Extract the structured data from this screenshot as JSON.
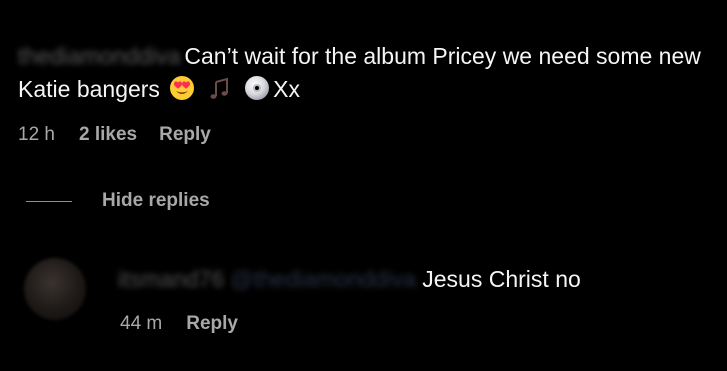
{
  "comment": {
    "username": "thediamonddiva",
    "text": "Can’t wait for the album Pricey we need some new Katie bangers",
    "emojis": [
      "heart-eyes-emoji",
      "music-notes-emoji",
      "dvd-emoji"
    ],
    "suffix": "Xx",
    "time": "12 h",
    "likes": "2 likes",
    "reply_label": "Reply"
  },
  "thread": {
    "hide_replies_label": "Hide replies"
  },
  "reply": {
    "username": "itsmand76",
    "mention": "@thediamonddiva",
    "text": "Jesus Christ no",
    "time": "44 m",
    "reply_label": "Reply"
  }
}
